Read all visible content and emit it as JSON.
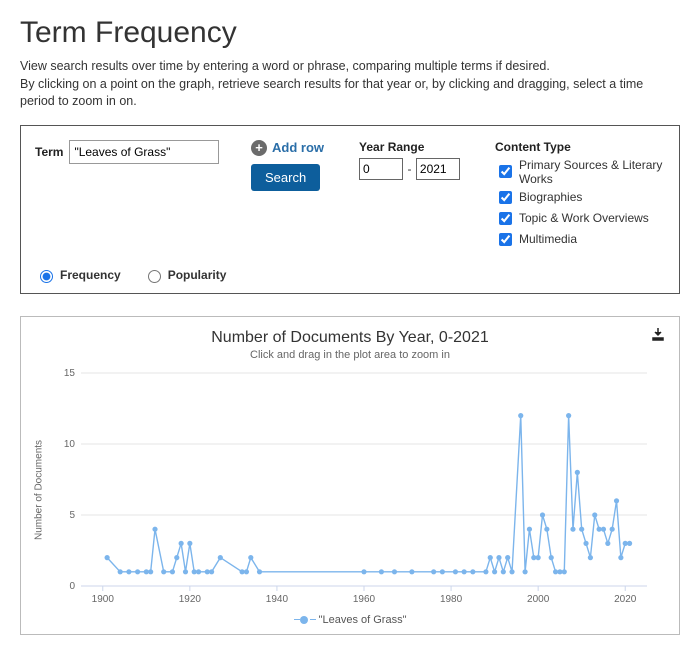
{
  "page": {
    "title": "Term Frequency",
    "description_line1": "View search results over time by entering a word or phrase, comparing multiple terms if desired.",
    "description_line2": "By clicking on a point on the graph, retrieve search results for that year or, by clicking and dragging, select a time period to zoom in on."
  },
  "form": {
    "term_label": "Term",
    "term_value": "\"Leaves of Grass\"",
    "add_row_label": "Add row",
    "search_label": "Search",
    "year_range_label": "Year Range",
    "year_from": "0",
    "year_to": "2021",
    "content_type_label": "Content Type",
    "content_types": [
      {
        "label": "Primary Sources & Literary Works",
        "checked": true
      },
      {
        "label": "Biographies",
        "checked": true
      },
      {
        "label": "Topic & Work Overviews",
        "checked": true
      },
      {
        "label": "Multimedia",
        "checked": true
      }
    ],
    "mode": {
      "frequency": "Frequency",
      "popularity": "Popularity",
      "selected": "Frequency"
    }
  },
  "chart": {
    "title": "Number of Documents By Year, 0-2021",
    "subtitle": "Click and drag in the plot area to zoom in",
    "y_axis_label": "Number of Documents",
    "legend_label": "\"Leaves of Grass\"",
    "x_ticks": [
      1900,
      1920,
      1940,
      1960,
      1980,
      2000,
      2020
    ],
    "y_ticks": [
      0,
      5,
      10,
      15
    ]
  },
  "chart_data": {
    "type": "line",
    "title": "Number of Documents By Year, 0-2021",
    "xlabel": "",
    "ylabel": "Number of Documents",
    "ylim": [
      0,
      15
    ],
    "xlim": [
      1895,
      2025
    ],
    "series": [
      {
        "name": "\"Leaves of Grass\"",
        "x": [
          1901,
          1904,
          1906,
          1908,
          1910,
          1911,
          1912,
          1914,
          1916,
          1917,
          1918,
          1919,
          1920,
          1921,
          1922,
          1924,
          1925,
          1927,
          1932,
          1933,
          1934,
          1936,
          1960,
          1964,
          1967,
          1971,
          1976,
          1978,
          1981,
          1983,
          1985,
          1988,
          1989,
          1990,
          1991,
          1992,
          1993,
          1994,
          1996,
          1997,
          1998,
          1999,
          2000,
          2001,
          2002,
          2003,
          2004,
          2005,
          2006,
          2007,
          2008,
          2009,
          2010,
          2011,
          2012,
          2013,
          2014,
          2015,
          2016,
          2017,
          2018,
          2019,
          2020,
          2021
        ],
        "values": [
          2,
          1,
          1,
          1,
          1,
          1,
          4,
          1,
          1,
          2,
          3,
          1,
          3,
          1,
          1,
          1,
          1,
          2,
          1,
          1,
          2,
          1,
          1,
          1,
          1,
          1,
          1,
          1,
          1,
          1,
          1,
          1,
          2,
          1,
          2,
          1,
          2,
          1,
          12,
          1,
          4,
          2,
          2,
          5,
          4,
          2,
          1,
          1,
          1,
          12,
          4,
          8,
          4,
          3,
          2,
          5,
          4,
          4,
          3,
          4,
          6,
          2,
          3,
          3
        ]
      }
    ]
  }
}
